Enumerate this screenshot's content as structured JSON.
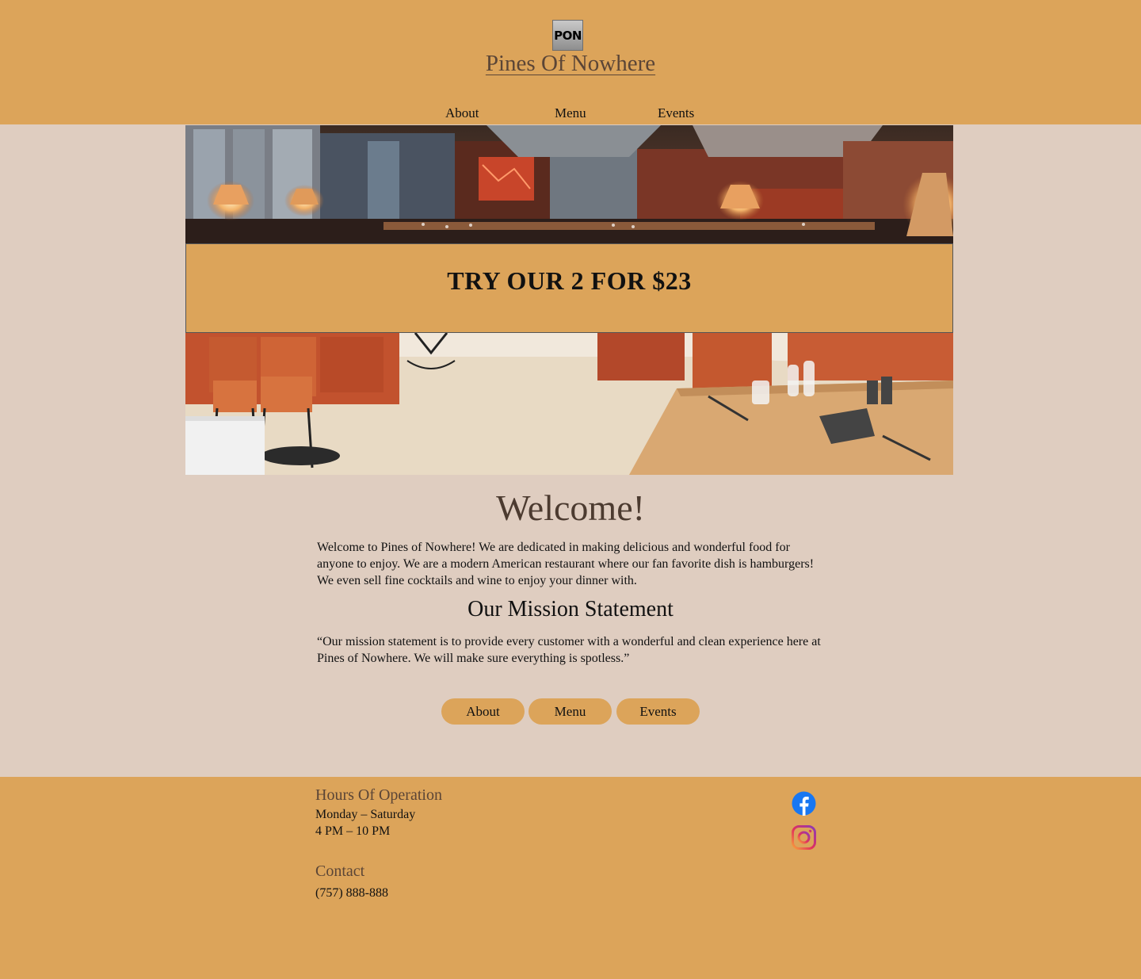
{
  "header": {
    "logo_text": "PON",
    "site_title": "Pines Of Nowhere",
    "nav": [
      "About",
      "Menu",
      "Events"
    ]
  },
  "promo": {
    "text": "TRY OUR 2 FOR $23"
  },
  "main": {
    "welcome_heading": "Welcome!",
    "welcome_text": "Welcome to Pines of Nowhere! We are dedicated in making delicious and wonderful food for anyone to enjoy. We are a modern American restaurant where our fan favorite dish is hamburgers! We even sell fine cocktails and wine to enjoy your dinner with.",
    "mission_heading": "Our Mission Statement",
    "mission_text": "“Our mission statement is to provide every customer with a wonderful and clean experience here at Pines of Nowhere. We will make sure everything is spotless.”",
    "buttons": [
      "About",
      "Menu",
      "Events"
    ]
  },
  "footer": {
    "hours_heading": "Hours Of Operation",
    "hours_days": "Monday  – Saturday",
    "hours_times": "4 PM  – 10 PM",
    "contact_heading": "Contact",
    "phone": "(757) 888-888",
    "social_icons": [
      "facebook-icon",
      "instagram-icon"
    ]
  },
  "colors": {
    "accent": "#dca45a",
    "background": "#dfcdc0",
    "title": "#5b4536"
  }
}
